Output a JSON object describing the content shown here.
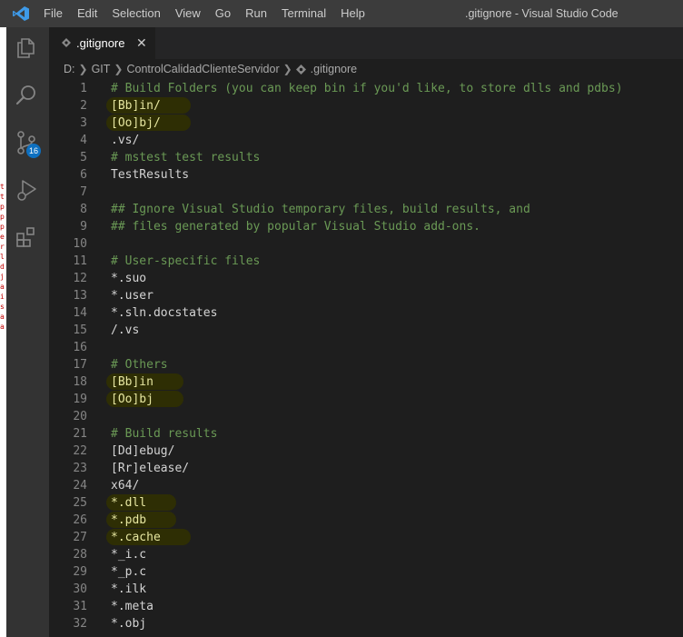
{
  "window": {
    "title": ".gitignore - Visual Studio Code"
  },
  "menu": [
    "File",
    "Edit",
    "Selection",
    "View",
    "Go",
    "Run",
    "Terminal",
    "Help"
  ],
  "activity_bar": {
    "icons": [
      "explorer-icon",
      "search-icon",
      "source-control-icon",
      "run-debug-icon",
      "extensions-icon"
    ],
    "scm_badge": "16",
    "edge_glyphs": "t\nt\np\np\np\ne\nr\nl\nd\nj\na\ni\ns\na\na"
  },
  "tab": {
    "label": ".gitignore",
    "close": "✕"
  },
  "breadcrumb": [
    "D:",
    "GIT",
    "ControlCalidadClienteServidor",
    ".gitignore"
  ],
  "colors": {
    "comment": "#6a9955",
    "text": "#d4d4d4",
    "line_number": "#858585",
    "highlight": "#2e2e04",
    "accent": "#0e70c0"
  },
  "lines": [
    {
      "n": "1",
      "text": "# Build Folders (you can keep bin if you'd like, to store dlls and pdbs)",
      "type": "comment"
    },
    {
      "n": "2",
      "text": "[Bb]in/",
      "type": "text",
      "highlight": true
    },
    {
      "n": "3",
      "text": "[Oo]bj/",
      "type": "text",
      "highlight": true
    },
    {
      "n": "4",
      "text": ".vs/",
      "type": "text"
    },
    {
      "n": "5",
      "text": "# mstest test results",
      "type": "comment"
    },
    {
      "n": "6",
      "text": "TestResults",
      "type": "text"
    },
    {
      "n": "7",
      "text": "",
      "type": "text"
    },
    {
      "n": "8",
      "text": "## Ignore Visual Studio temporary files, build results, and",
      "type": "comment"
    },
    {
      "n": "9",
      "text": "## files generated by popular Visual Studio add-ons.",
      "type": "comment"
    },
    {
      "n": "10",
      "text": "",
      "type": "text"
    },
    {
      "n": "11",
      "text": "# User-specific files",
      "type": "comment"
    },
    {
      "n": "12",
      "text": "*.suo",
      "type": "text"
    },
    {
      "n": "13",
      "text": "*.user",
      "type": "text"
    },
    {
      "n": "14",
      "text": "*.sln.docstates",
      "type": "text"
    },
    {
      "n": "15",
      "text": "/.vs",
      "type": "text"
    },
    {
      "n": "16",
      "text": "",
      "type": "text"
    },
    {
      "n": "17",
      "text": "# Others",
      "type": "comment"
    },
    {
      "n": "18",
      "text": "[Bb]in",
      "type": "text",
      "highlight": true
    },
    {
      "n": "19",
      "text": "[Oo]bj",
      "type": "text",
      "highlight": true
    },
    {
      "n": "20",
      "text": "",
      "type": "text"
    },
    {
      "n": "21",
      "text": "# Build results",
      "type": "comment"
    },
    {
      "n": "22",
      "text": "[Dd]ebug/",
      "type": "text"
    },
    {
      "n": "23",
      "text": "[Rr]elease/",
      "type": "text"
    },
    {
      "n": "24",
      "text": "x64/",
      "type": "text"
    },
    {
      "n": "25",
      "text": "*.dll",
      "type": "text",
      "highlight": true
    },
    {
      "n": "26",
      "text": "*.pdb",
      "type": "text",
      "highlight": true
    },
    {
      "n": "27",
      "text": "*.cache",
      "type": "text",
      "highlight": true
    },
    {
      "n": "28",
      "text": "*_i.c",
      "type": "text"
    },
    {
      "n": "29",
      "text": "*_p.c",
      "type": "text"
    },
    {
      "n": "30",
      "text": "*.ilk",
      "type": "text"
    },
    {
      "n": "31",
      "text": "*.meta",
      "type": "text"
    },
    {
      "n": "32",
      "text": "*.obj",
      "type": "text"
    }
  ]
}
